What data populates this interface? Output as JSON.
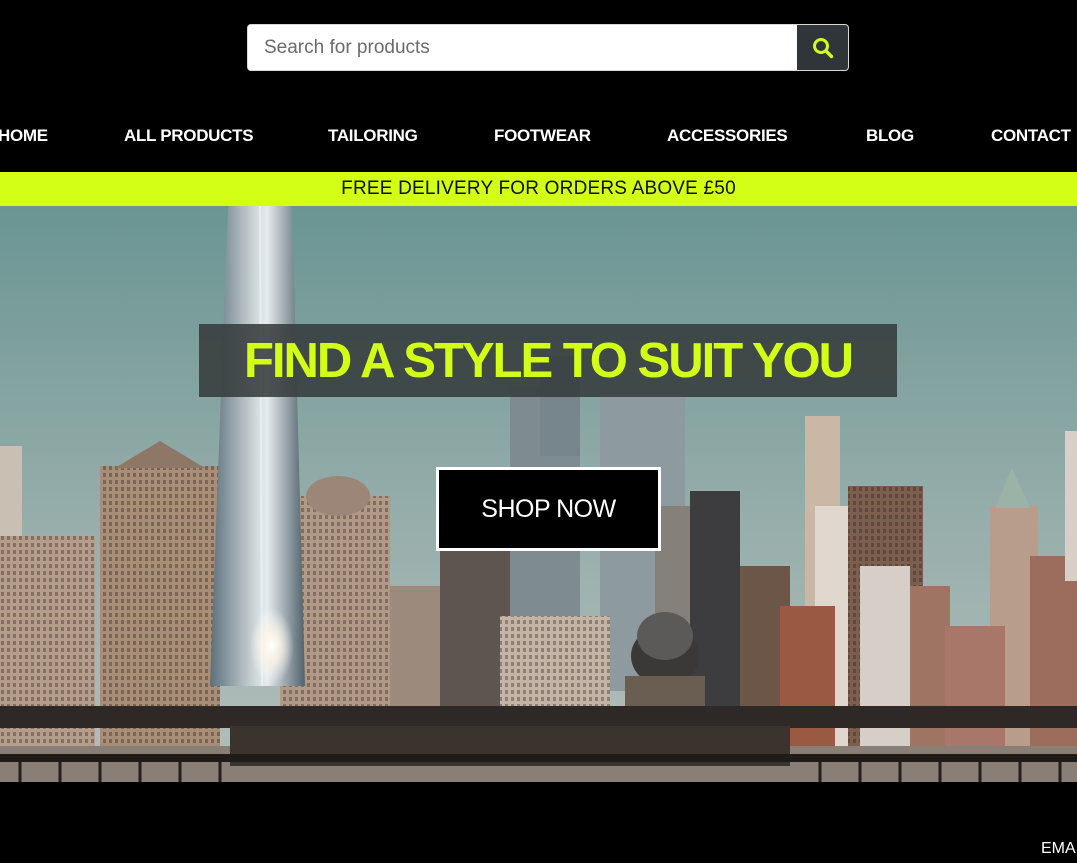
{
  "search": {
    "placeholder": "Search for products",
    "value": "",
    "button_icon": "search-icon",
    "icon_color": "#d3ff16"
  },
  "nav": {
    "items": [
      {
        "label": "HOME"
      },
      {
        "label": "ALL PRODUCTS"
      },
      {
        "label": "TAILORING"
      },
      {
        "label": "FOOTWEAR"
      },
      {
        "label": "ACCESSORIES"
      },
      {
        "label": "BLOG"
      },
      {
        "label": "CONTACT"
      }
    ]
  },
  "promo": {
    "text": "FREE DELIVERY FOR ORDERS ABOVE £50",
    "background": "#d3ff16"
  },
  "hero": {
    "headline": "FIND A STYLE TO SUIT YOU",
    "headline_color": "#d3ff16",
    "cta_label": "SHOP NOW"
  },
  "footer": {
    "email_label": "EMA"
  }
}
